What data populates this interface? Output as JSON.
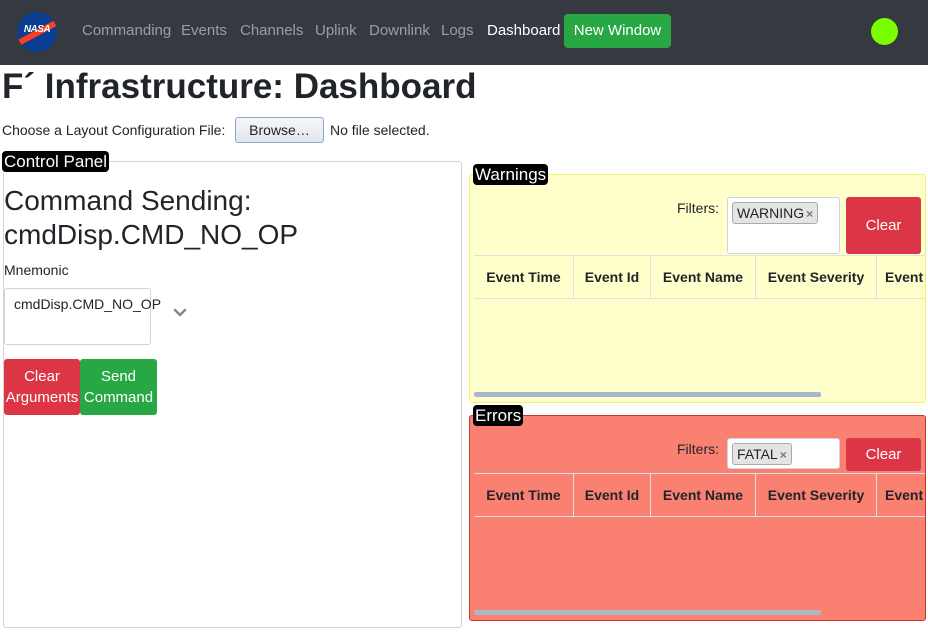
{
  "nav": {
    "logo_text": "NASA",
    "links": [
      "Commanding",
      "Events",
      "Channels",
      "Uplink",
      "Downlink",
      "Logs",
      "Dashboard"
    ],
    "active_link": "Dashboard",
    "new_window_label": "New Window",
    "status_color": "#7cfc00"
  },
  "header": {
    "title": "F´ Infrastructure: Dashboard",
    "layout_label": "Choose a Layout Configuration File:",
    "browse_label": "Browse…",
    "no_file_text": "No file selected."
  },
  "control_panel": {
    "legend": "Control Panel",
    "heading": "Command Sending: cmdDisp.CMD_NO_OP",
    "mnemonic_label": "Mnemonic",
    "mnemonic_value": "cmdDisp.CMD_NO_OP",
    "clear_args_label": "Clear Arguments",
    "send_command_label": "Send Command"
  },
  "warnings": {
    "legend": "Warnings",
    "filters_label": "Filters:",
    "filter_tag": "WARNING",
    "clear_label": "Clear",
    "columns": [
      "Event Time",
      "Event Id",
      "Event Name",
      "Event Severity",
      "Event Description"
    ],
    "bg_color": "#ffffcc"
  },
  "errors": {
    "legend": "Errors",
    "filters_label": "Filters:",
    "filter_tag": "FATAL",
    "clear_label": "Clear",
    "columns": [
      "Event Time",
      "Event Id",
      "Event Name",
      "Event Severity",
      "Event Description"
    ],
    "bg_color": "#fa8072"
  },
  "icons": {
    "tag_remove": "×",
    "chevron": "chevron-down-icon"
  }
}
